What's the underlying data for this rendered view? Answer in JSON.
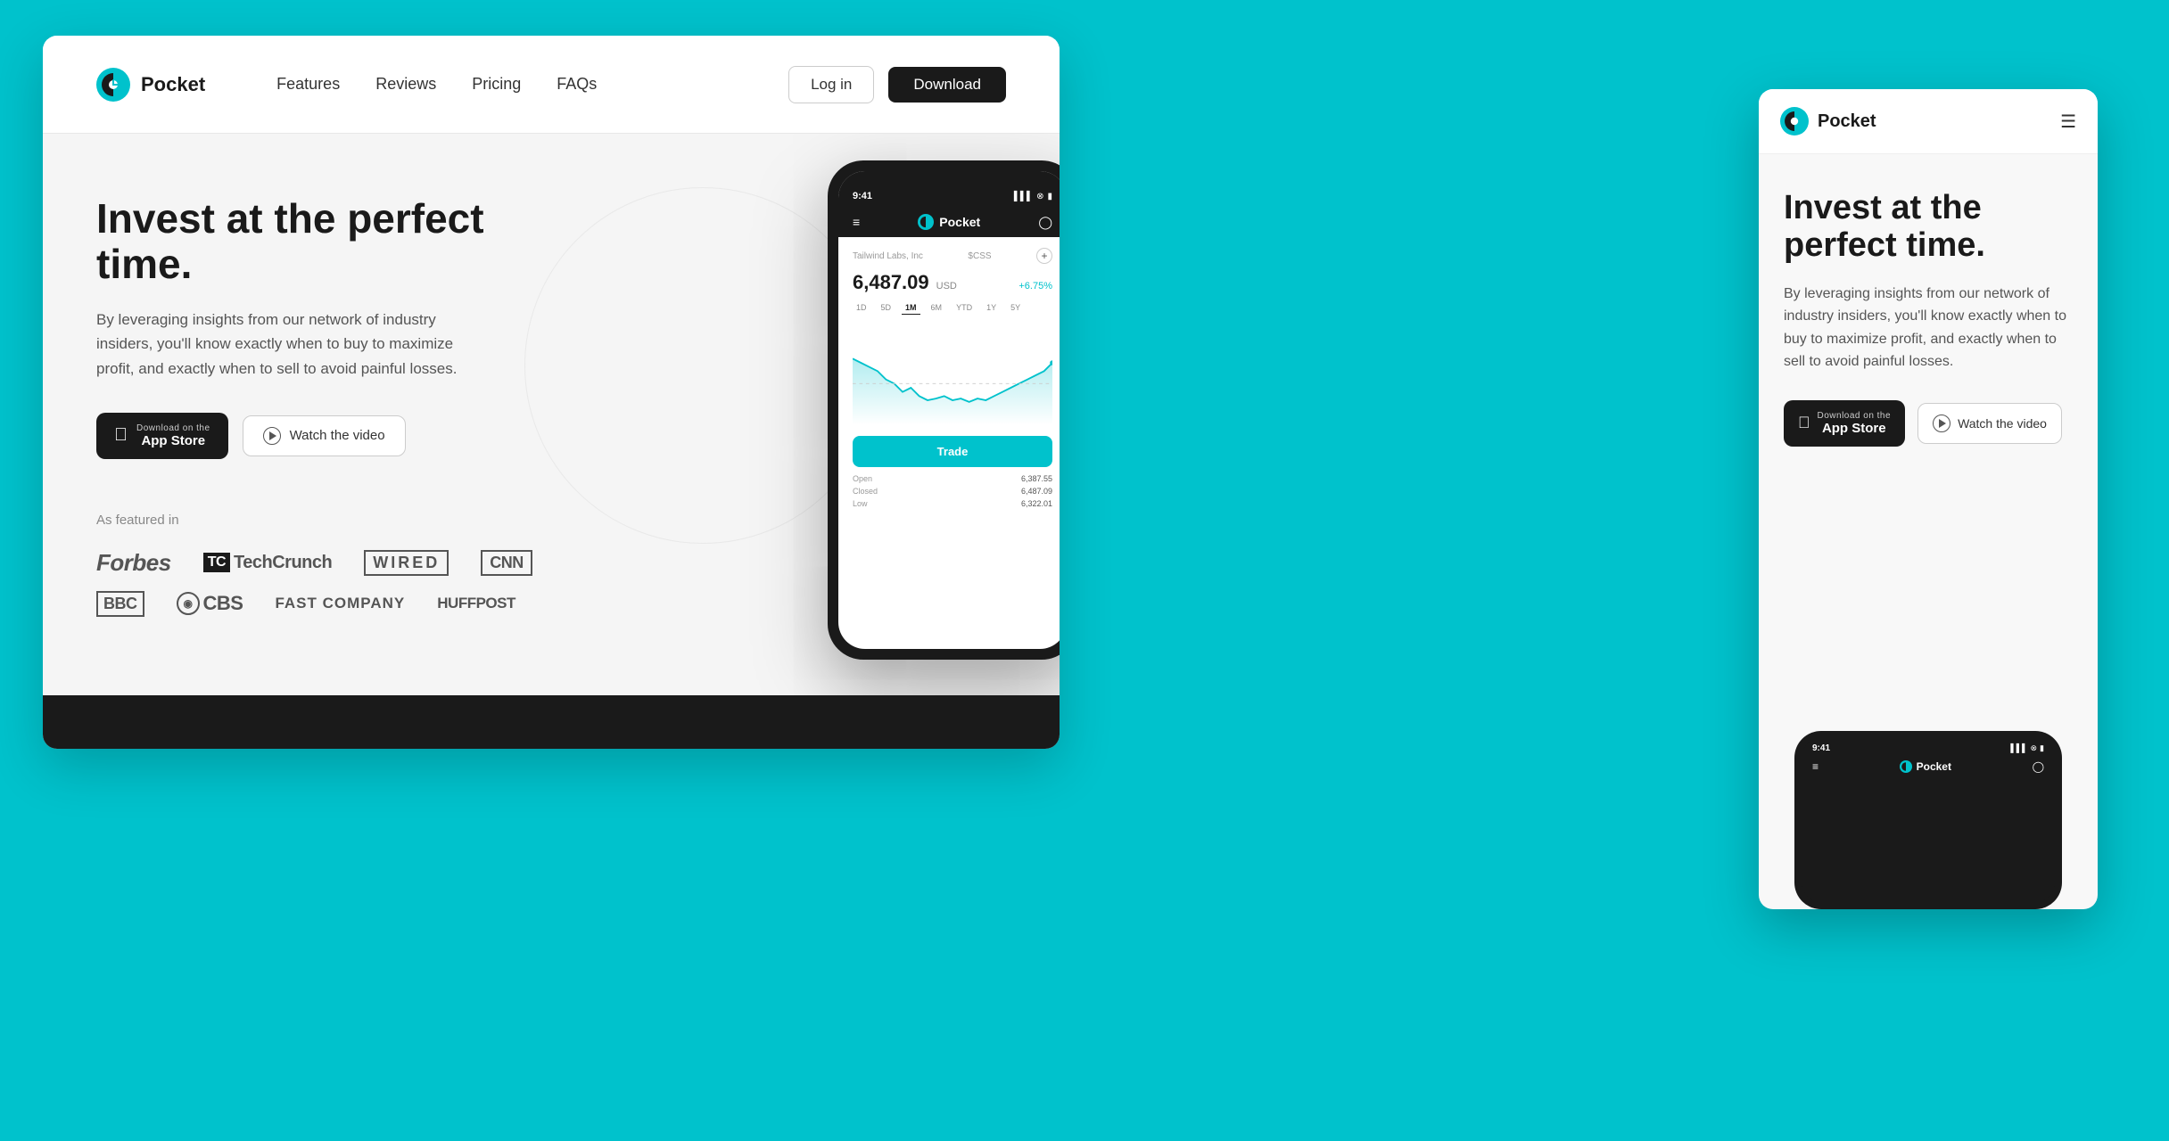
{
  "brand": {
    "name": "Pocket",
    "logo_alt": "Pocket logo"
  },
  "desktop": {
    "nav": {
      "links": [
        {
          "label": "Features",
          "id": "features"
        },
        {
          "label": "Reviews",
          "id": "reviews"
        },
        {
          "label": "Pricing",
          "id": "pricing"
        },
        {
          "label": "FAQs",
          "id": "faqs"
        }
      ],
      "login_label": "Log in",
      "download_label": "Download"
    },
    "hero": {
      "title": "Invest at the perfect time.",
      "description": "By leveraging insights from our network of industry insiders, you'll know exactly when to buy to maximize profit, and exactly when to sell to avoid painful losses.",
      "appstore_sub": "Download on the",
      "appstore_main": "App Store",
      "watch_label": "Watch the video"
    },
    "featured": {
      "label": "As featured in",
      "logos": [
        {
          "name": "Forbes",
          "type": "text"
        },
        {
          "name": "TechCrunch",
          "type": "tc"
        },
        {
          "name": "WIRED",
          "type": "wired"
        },
        {
          "name": "CNN",
          "type": "cnn"
        },
        {
          "name": "BBC",
          "type": "bbc"
        },
        {
          "name": "CBS",
          "type": "cbs"
        },
        {
          "name": "Fast Company",
          "type": "fast"
        },
        {
          "name": "HuffPost",
          "type": "huff"
        }
      ]
    },
    "phone": {
      "time": "9:41",
      "app_name": "Pocket",
      "stock_company": "Tailwind Labs, Inc",
      "stock_ticker": "$CSS",
      "stock_price": "6,487.09",
      "stock_currency": "USD",
      "stock_change": "+6.75%",
      "time_tabs": [
        "1D",
        "5D",
        "1M",
        "6M",
        "YTD",
        "1Y",
        "5Y"
      ],
      "active_tab": "1M",
      "trade_label": "Trade",
      "open_label": "Open",
      "open_value": "6,387.55",
      "closed_label": "Closed",
      "closed_value": "6,487.09",
      "low_label": "Low",
      "low_value": "6,322.01"
    }
  },
  "mobile": {
    "nav": {
      "name": "Pocket",
      "hamburger_label": "Menu"
    },
    "hero": {
      "title": "Invest at the perfect time.",
      "description": "By leveraging insights from our network of industry insiders, you'll know exactly when to buy to maximize profit, and exactly when to sell to avoid painful losses.",
      "appstore_sub": "Download on the",
      "appstore_main": "App Store",
      "watch_label": "Watch the video"
    },
    "phone": {
      "time": "9:41",
      "app_name": "Pocket"
    }
  },
  "colors": {
    "brand_teal": "#00C2CC",
    "dark": "#1a1a1a",
    "white": "#ffffff",
    "light_bg": "#f5f5f5"
  }
}
